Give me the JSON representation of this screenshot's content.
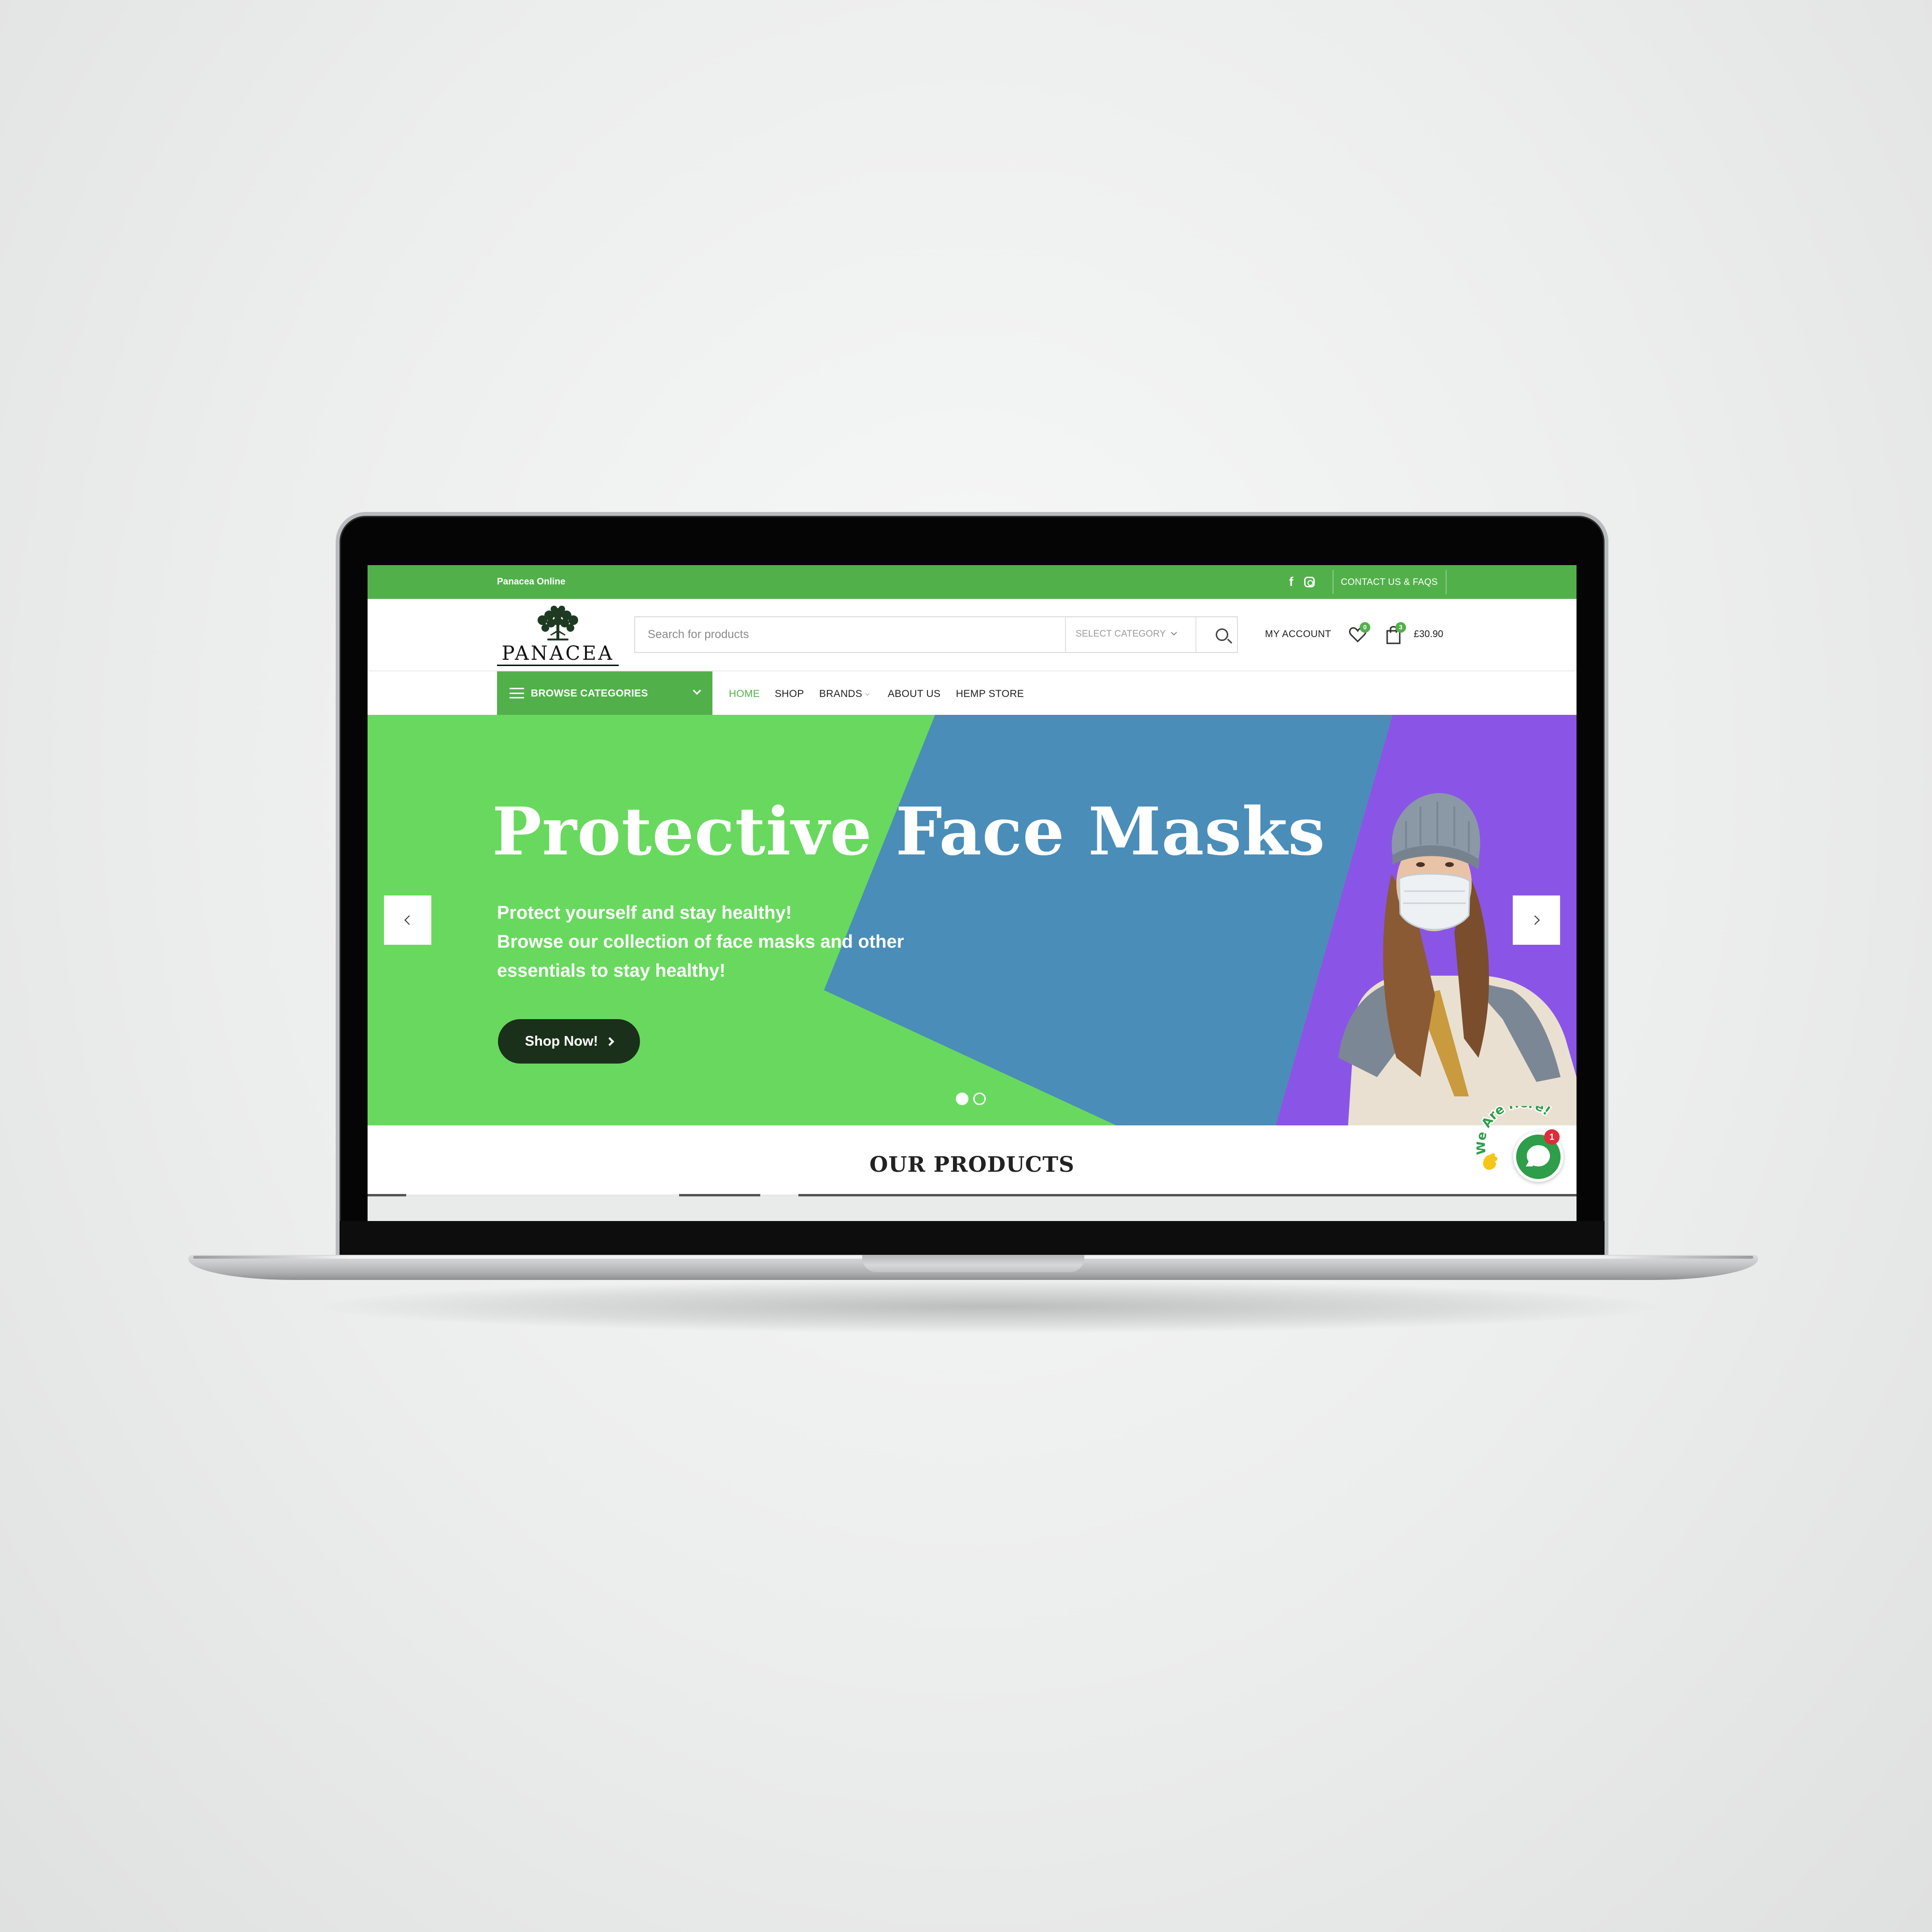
{
  "topbar": {
    "brand_text": "Panacea Online",
    "contact_link": "CONTACT US & FAQS"
  },
  "header": {
    "logo_text": "PANACEA",
    "search": {
      "placeholder": "Search for products",
      "category_select": "SELECT CATEGORY"
    },
    "my_account": "MY ACCOUNT",
    "wishlist_count": "0",
    "cart_count": "3",
    "cart_total": "£30.90"
  },
  "nav": {
    "browse_categories": "BROWSE CATEGORIES",
    "items": [
      "HOME",
      "SHOP",
      "BRANDS",
      "ABOUT US",
      "HEMP STORE"
    ]
  },
  "hero": {
    "title": "Protective Face Masks",
    "subtitle_lines": [
      "Protect yourself and stay healthy!",
      "Browse our collection of face masks and other",
      "essentials to stay healthy!"
    ],
    "cta": "Shop Now!",
    "active_slide": 1,
    "slide_count": 2
  },
  "products": {
    "title": "OUR PRODUCTS"
  },
  "chat_widget": {
    "label": "We Are Here!",
    "badge_count": "1"
  },
  "colors": {
    "brand_green": "#52b04b",
    "hero_green": "#68d95e",
    "hero_blue": "#4a8db8",
    "hero_purple": "#8a55e6",
    "cta_dark": "#1b301a"
  }
}
